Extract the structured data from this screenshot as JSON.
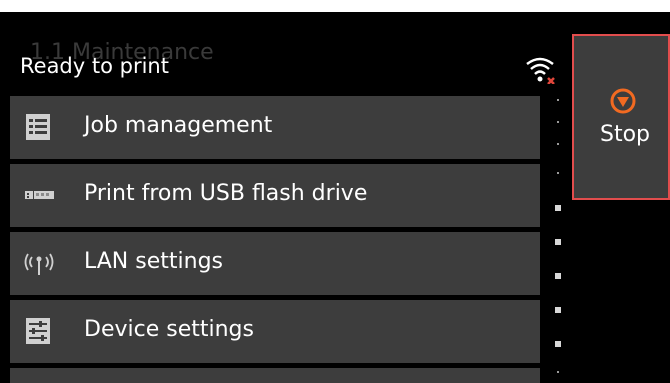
{
  "status": {
    "ghost_text": "1.1   Maintenance",
    "text": "Ready to print"
  },
  "menu": {
    "items": [
      {
        "label": "Job management",
        "icon": "list-icon"
      },
      {
        "label": "Print from USB flash drive",
        "icon": "usb-icon"
      },
      {
        "label": "LAN settings",
        "icon": "antenna-icon"
      },
      {
        "label": "Device settings",
        "icon": "sliders-icon"
      }
    ]
  },
  "stop": {
    "label": "Stop",
    "icon": "stop-icon"
  },
  "colors": {
    "accent": "#f26a21",
    "border": "#e24d4d",
    "item_bg": "#3d3d3d"
  }
}
